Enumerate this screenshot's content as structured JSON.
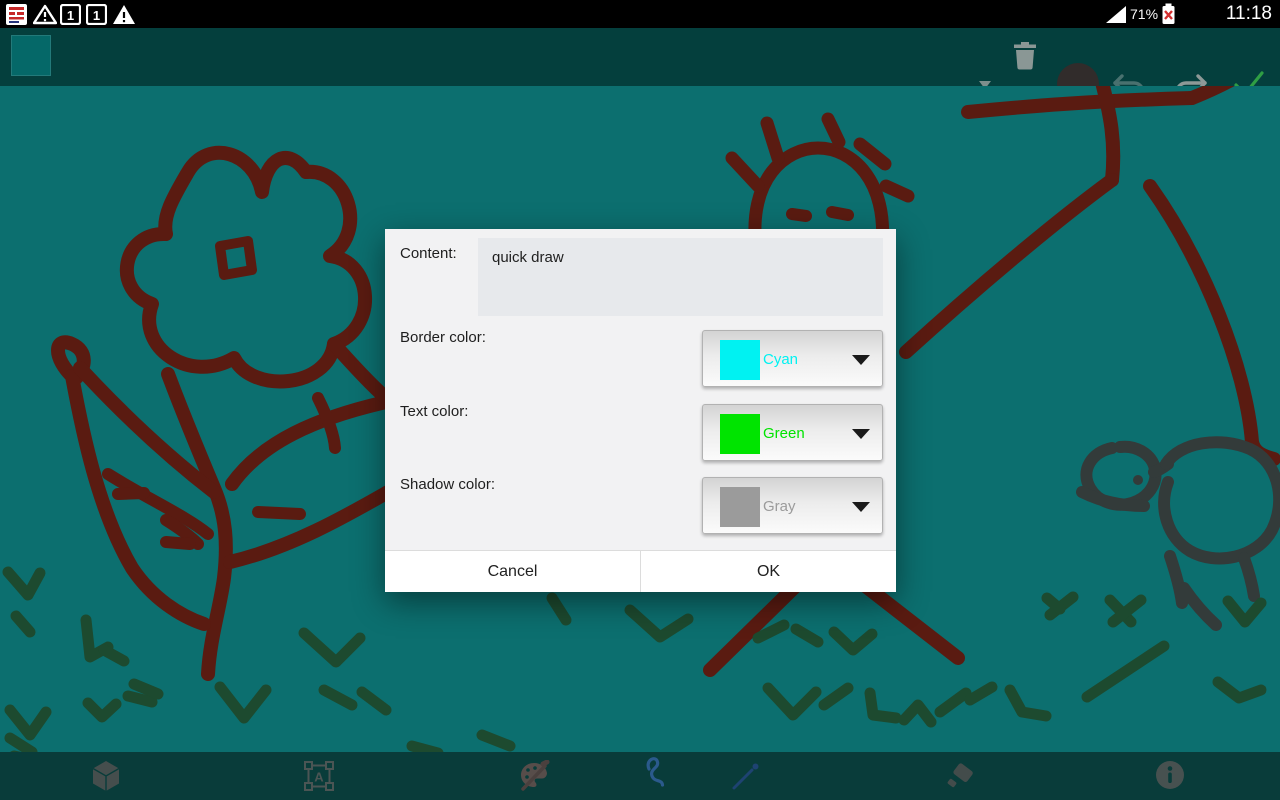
{
  "status_bar": {
    "time": "11:18",
    "battery_percent": "71%",
    "notification_badges": [
      "1",
      "1"
    ],
    "left_icons": [
      "app-notification-icon",
      "warning-outline-icon",
      "badge-1-icon",
      "badge-1-icon",
      "warning-filled-icon"
    ],
    "right_icons": [
      "signal-icon",
      "battery-x-icon"
    ]
  },
  "top_toolbar": {
    "swatch_color": "#056868",
    "icons": [
      "dropdown-caret-icon",
      "trash-icon",
      "current-color-circle",
      "undo-icon",
      "redo-icon",
      "confirm-check-icon"
    ],
    "undo_color": "#49716f",
    "redo_color": "#8d9997",
    "check_color": "#2f9e44",
    "trash_color": "#8a9795",
    "circle_color": "#312c2b"
  },
  "dialog": {
    "content_label": "Content:",
    "content_value": "quick draw",
    "fields": [
      {
        "label": "Border color:",
        "value": "Cyan",
        "color": "#00f2f2"
      },
      {
        "label": "Text color:",
        "value": "Green",
        "color": "#00e400"
      },
      {
        "label": "Shadow color:",
        "value": "Gray",
        "color": "#9b9b9b"
      }
    ],
    "buttons": {
      "cancel": "Cancel",
      "ok": "OK"
    }
  },
  "canvas": {
    "colors": {
      "background": "#0c6f6f",
      "dark_red": "#5a1b11",
      "dark_green": "#1d4a2f",
      "charcoal": "#333b3a"
    },
    "doodles": [
      "flower-with-leaves",
      "sun-face",
      "stick-figure",
      "animal-figure",
      "grass-marks"
    ]
  },
  "bottom_toolbar": {
    "tools": [
      "cube-tool",
      "text-select-tool",
      "palette-tool",
      "freehand-tool",
      "line-tool",
      "eraser-tool",
      "info-tool"
    ],
    "text_tool_letter": "A",
    "tool_gray": "#4b5554",
    "freehand_blue": "#2b5a8c",
    "line_blue": "#1e4372"
  }
}
